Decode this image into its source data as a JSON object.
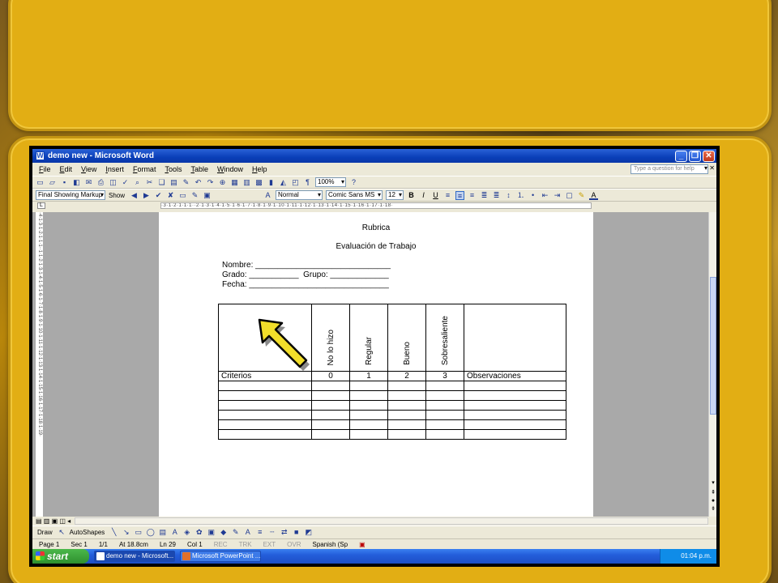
{
  "window": {
    "title": "demo new - Microsoft Word",
    "icon_letter": "W"
  },
  "menu": {
    "items": [
      "File",
      "Edit",
      "View",
      "Insert",
      "Format",
      "Tools",
      "Table",
      "Window",
      "Help"
    ],
    "help_placeholder": "Type a question for help"
  },
  "toolbar": {
    "zoom": "100%",
    "markup_mode": "Final Showing Markup",
    "show_label": "Show",
    "style": "Normal",
    "font": "Comic Sans MS",
    "font_size": "12"
  },
  "document": {
    "title": "Rubrica",
    "subtitle": "Evaluación de Trabajo",
    "line_nombre": "Nombre: ______________________________",
    "line_grado": "Grado: ___________  Grupo: _____________",
    "line_fecha": "Fecha: _______________________________",
    "table": {
      "header_vertical": [
        "No lo hizo",
        "Regular",
        "Bueno",
        "Sobresaliente"
      ],
      "row_labels": {
        "criterios": "Criterios",
        "scores": [
          "0",
          "1",
          "2",
          "3"
        ],
        "observaciones": "Observaciones"
      },
      "empty_rows": 6
    }
  },
  "drawing_bar": {
    "draw": "Draw",
    "autoshapes": "AutoShapes"
  },
  "status": {
    "page": "Page 1",
    "sec": "Sec 1",
    "pages": "1/1",
    "at": "At 18.8cm",
    "ln": "Ln 29",
    "col": "Col 1",
    "rec": "REC",
    "trk": "TRK",
    "ext": "EXT",
    "ovr": "OVR",
    "lang": "Spanish (Sp"
  },
  "taskbar": {
    "start": "start",
    "tasks": [
      "demo new - Microsoft...",
      "Microsoft PowerPoint ..."
    ],
    "clock": "01:04 p.m."
  },
  "colors": {
    "slide_gold": "#e2ae14",
    "title_blue": "#0a3fb8",
    "arrow_yellow": "#f2de2a"
  }
}
